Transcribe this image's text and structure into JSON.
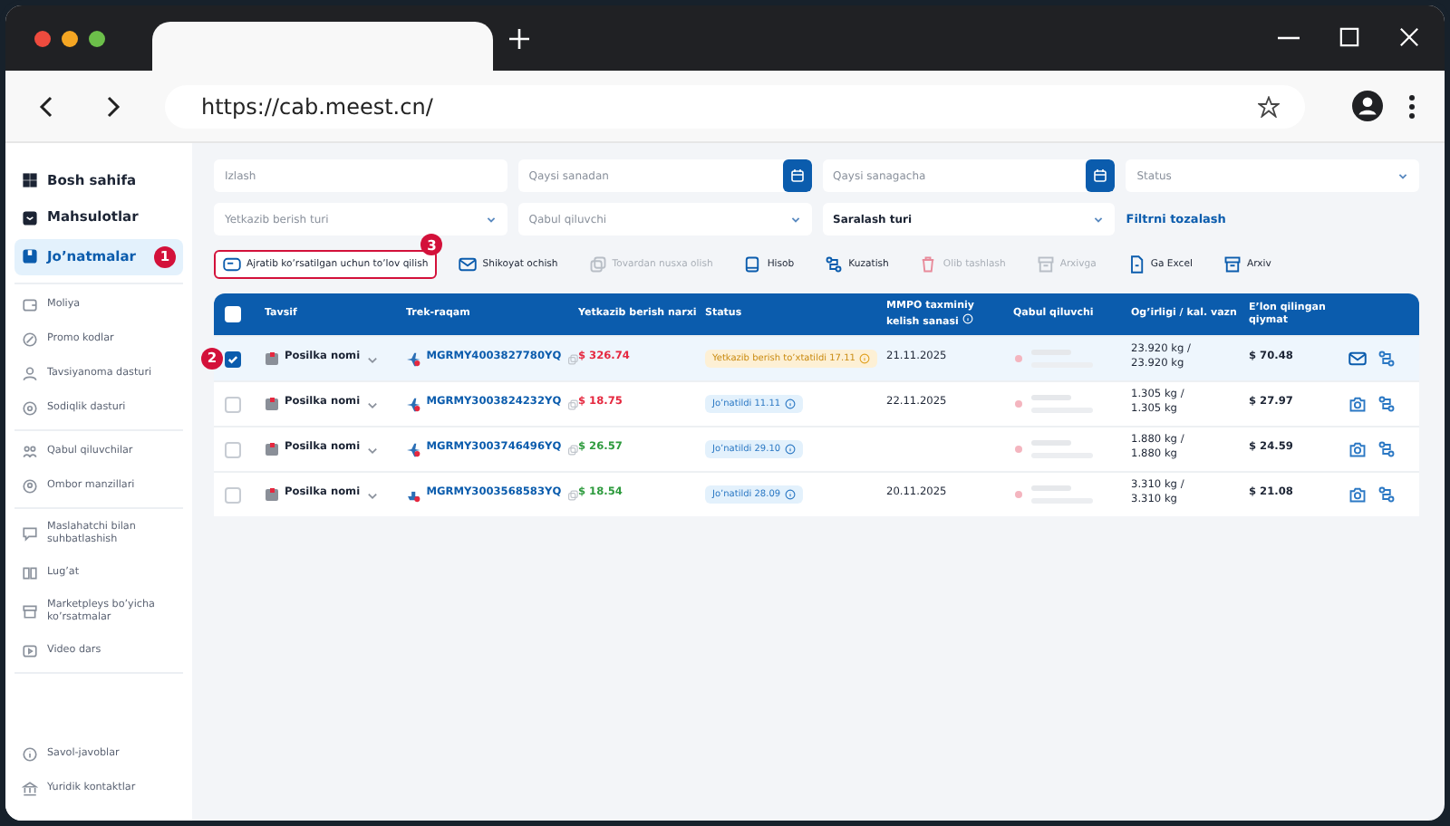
{
  "browser": {
    "url": "https://cab.meest.cn/"
  },
  "sidebar": {
    "groups": [
      {
        "items": [
          {
            "label": "Bosh sahifa",
            "selected": false
          },
          {
            "label": "Mahsulotlar",
            "selected": false
          },
          {
            "label": "Jo’natmalar",
            "selected": true,
            "badge": "1"
          }
        ]
      },
      {
        "items": [
          {
            "label": "Moliya",
            "selected": false
          },
          {
            "label": "Promo kodlar",
            "selected": false
          },
          {
            "label": "Tavsiyanoma dasturi",
            "selected": false
          },
          {
            "label": "Sodiqlik dasturi",
            "selected": false
          }
        ]
      },
      {
        "items": [
          {
            "label": "Qabul qiluvchilar",
            "selected": false
          },
          {
            "label": "Ombor manzillari",
            "selected": false
          }
        ]
      },
      {
        "items": [
          {
            "label": "Maslahatchi bilan suhbatlashish",
            "selected": false
          },
          {
            "label": "Lug’at",
            "selected": false
          },
          {
            "label": "Marketpleys bo’yicha ko’rsatmalar",
            "selected": false
          },
          {
            "label": "Video dars",
            "selected": false
          }
        ]
      }
    ],
    "bottom": [
      {
        "label": "Savol-javoblar",
        "selected": false
      },
      {
        "label": "Yuridik kontaktlar",
        "selected": false
      }
    ]
  },
  "filters": [
    {
      "kind": "text",
      "placeholder": "Izlash"
    },
    {
      "kind": "date",
      "placeholder": "Qaysi sanadan"
    },
    {
      "kind": "date",
      "placeholder": "Qaysi sanagacha"
    },
    {
      "kind": "select",
      "placeholder": "Status"
    },
    {
      "kind": "select",
      "placeholder": "Yetkazib berish turi"
    },
    {
      "kind": "select",
      "placeholder": "Qabul qiluvchi"
    },
    {
      "kind": "select",
      "value": "Saralash turi"
    },
    {
      "kind": "link",
      "label": "Filtrni tozalash"
    }
  ],
  "actions": [
    {
      "label": "Ajratib ko’rsatilgan uchun to’lov qilish",
      "disabled": false,
      "highlighted": true,
      "badge": "3"
    },
    {
      "label": "Shikoyat ochish",
      "disabled": false,
      "highlighted": false
    },
    {
      "label": "Tovardan nusxa olish",
      "disabled": true,
      "highlighted": false
    },
    {
      "label": "Hisob",
      "disabled": false,
      "highlighted": false
    },
    {
      "label": "Kuzatish",
      "disabled": false,
      "highlighted": false
    },
    {
      "label": "Olib tashlash",
      "disabled": true,
      "highlighted": false
    },
    {
      "label": "Arxivga",
      "disabled": true,
      "highlighted": false
    },
    {
      "label": "Ga Excel",
      "disabled": false,
      "highlighted": false
    },
    {
      "label": "Arxiv",
      "disabled": false,
      "highlighted": false
    }
  ],
  "table": {
    "all_checked": false,
    "columns": [
      "Tavsif",
      "Trek-raqam",
      "Yetkazib berish narxi",
      "Status",
      "MMPO taxminiy kelish sanasi",
      "Qabul qiluvchi",
      "Og’irligi / kal. vazn",
      "E’lon qilingan qiymat"
    ],
    "rows": [
      {
        "checked": true,
        "badge": "2",
        "name": "Posilka nomi",
        "track": {
          "kind": "air",
          "text": "MGRMY4003827780YQ"
        },
        "price": {
          "text": "$ 326.74",
          "color": "#e5283f"
        },
        "status": {
          "kind": "warning",
          "text": "Yetkazib berish to’xtatildi 17.11"
        },
        "date": "21.11.2025",
        "weight": [
          "23.920 kg /",
          "23.920 kg"
        ],
        "value": "$ 70.48",
        "action": {
          "kind": "mail"
        }
      },
      {
        "checked": false,
        "name": "Posilka nomi",
        "track": {
          "kind": "air",
          "text": "MGRMY3003824232YQ"
        },
        "price": {
          "text": "$ 18.75",
          "color": "#e5283f"
        },
        "status": {
          "kind": "info",
          "text": "Jo’natildi 11.11"
        },
        "date": "22.11.2025",
        "weight": [
          "1.305 kg /",
          "1.305 kg"
        ],
        "value": "$ 27.97",
        "action": {
          "kind": "camera"
        }
      },
      {
        "checked": false,
        "name": "Posilka nomi",
        "track": {
          "kind": "air",
          "text": "MGRMY3003746496YQ"
        },
        "price": {
          "text": "$ 26.57",
          "color": "#2e9b3e"
        },
        "status": {
          "kind": "info",
          "text": "Jo’natildi 29.10"
        },
        "weight": [
          "1.880 kg /",
          "1.880 kg"
        ],
        "value": "$ 24.59",
        "action": {
          "kind": "camera"
        }
      },
      {
        "checked": false,
        "name": "Posilka nomi",
        "track": {
          "kind": "sea",
          "text": "MGRMY3003568583YQ"
        },
        "price": {
          "text": "$ 18.54",
          "color": "#2e9b3e"
        },
        "status": {
          "kind": "info",
          "text": "Jo’natildi 28.09"
        },
        "date": "20.11.2025",
        "weight": [
          "3.310 kg /",
          "3.310 kg"
        ],
        "value": "$ 21.08",
        "action": {
          "kind": "camera"
        }
      }
    ]
  }
}
